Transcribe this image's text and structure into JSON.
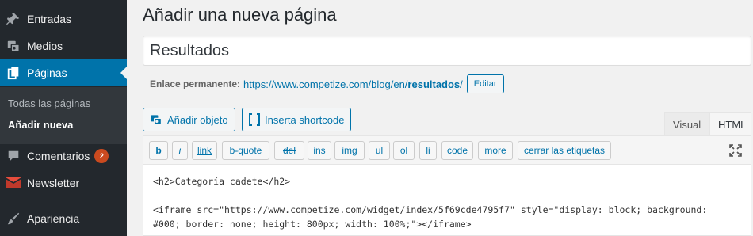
{
  "sidebar": {
    "items": [
      {
        "label": "Entradas",
        "icon": "pin-icon"
      },
      {
        "label": "Medios",
        "icon": "media-icon"
      },
      {
        "label": "Páginas",
        "icon": "pages-icon"
      },
      {
        "label": "Comentarios",
        "icon": "comments-icon",
        "badge": "2"
      },
      {
        "label": "Newsletter",
        "icon": "envelope-icon"
      },
      {
        "label": "Apariencia",
        "icon": "brush-icon"
      }
    ],
    "submenu": [
      "Todas las páginas",
      "Añadir nueva"
    ],
    "active": "Páginas"
  },
  "page": {
    "title": "Añadir una nueva página",
    "post_title": "Resultados",
    "permalink_label": "Enlace permanente:",
    "permalink_base": "https://www.competize.com/blog/en/",
    "permalink_slug": "resultados",
    "permalink_end": "/",
    "edit_label": "Editar"
  },
  "media": {
    "add_object": "Añadir objeto",
    "insert_shortcode": "Inserta shortcode"
  },
  "tabs": {
    "visual": "Visual",
    "html": "HTML"
  },
  "quicktags": [
    "b",
    "i",
    "link",
    "b-quote",
    "del",
    "ins",
    "img",
    "ul",
    "ol",
    "li",
    "code",
    "more",
    "cerrar las etiquetas"
  ],
  "content": {
    "line1": "<h2>Categoría cadete</h2>",
    "line2": "<iframe src=\"https://www.competize.com/widget/index/5f69cde4795f7\" style=\"display: block; background:",
    "line3": "#000; border: none; height: 800px; width: 100%;\"></iframe>"
  },
  "colors": {
    "sidebar": "#23282d",
    "active": "#0073aa",
    "badge": "#ca4a1f",
    "link": "#0073aa"
  }
}
